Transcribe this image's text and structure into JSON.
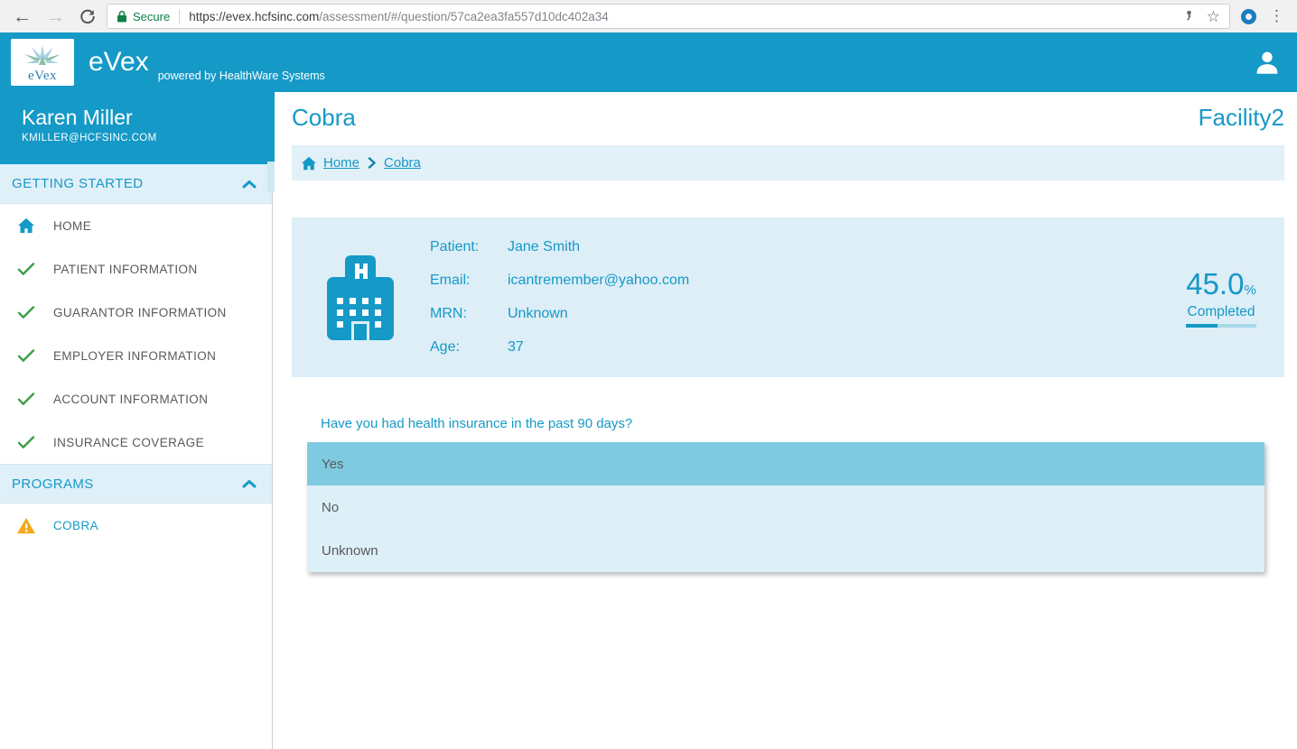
{
  "icons": {
    "back": "←",
    "forward": "→",
    "star": "☆",
    "menu_dots": "⋮"
  },
  "browser": {
    "secure_label": "Secure",
    "url_domain": "https://evex.hcfsinc.com",
    "url_path": "/assessment/#/question/57ca2ea3fa557d10dc402a34"
  },
  "header": {
    "logo_text": "eVex",
    "brand": "eVex",
    "tagline": "powered by HealthWare Systems"
  },
  "sidebar": {
    "user": {
      "name": "Karen Miller",
      "email": "KMILLER@HCFSINC.COM"
    },
    "sections": [
      {
        "label": "GETTING STARTED",
        "items": [
          {
            "label": "HOME",
            "icon": "home-icon"
          },
          {
            "label": "PATIENT INFORMATION",
            "icon": "check-icon"
          },
          {
            "label": "GUARANTOR INFORMATION",
            "icon": "check-icon"
          },
          {
            "label": "EMPLOYER INFORMATION",
            "icon": "check-icon"
          },
          {
            "label": "ACCOUNT INFORMATION",
            "icon": "check-icon"
          },
          {
            "label": "INSURANCE COVERAGE",
            "icon": "check-icon"
          }
        ]
      },
      {
        "label": "PROGRAMS",
        "items": [
          {
            "label": "COBRA",
            "icon": "warning-icon"
          }
        ]
      }
    ]
  },
  "main": {
    "title": "Cobra",
    "facility": "Facility2",
    "breadcrumb": {
      "home": "Home",
      "current": "Cobra"
    },
    "patient": {
      "rows": [
        {
          "label": "Patient:",
          "value": "Jane Smith"
        },
        {
          "label": "Email:",
          "value": "icantremember@yahoo.com"
        },
        {
          "label": "MRN:",
          "value": "Unknown"
        },
        {
          "label": "Age:",
          "value": "37"
        }
      ]
    },
    "progress": {
      "percent": "45.0",
      "percent_sign": "%",
      "label": "Completed",
      "fraction": 0.45
    },
    "question": "Have you had health insurance in the past 90 days?",
    "options": [
      {
        "label": "Yes"
      },
      {
        "label": "No"
      },
      {
        "label": "Unknown"
      }
    ],
    "selected_option": "Yes"
  },
  "colors": {
    "accent_teal": "#1599c7",
    "panel_light_blue": "#ddeef7",
    "selected_option_blue": "#7ecbe1",
    "check_green": "#3c9e47",
    "warning_orange": "#f5a81c",
    "secure_green": "#0b8043"
  }
}
